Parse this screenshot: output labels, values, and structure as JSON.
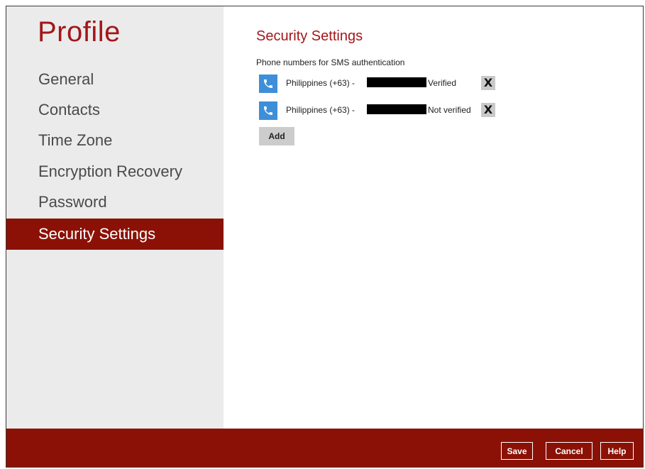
{
  "sidebar": {
    "title": "Profile",
    "items": [
      {
        "label": "General",
        "active": false
      },
      {
        "label": "Contacts",
        "active": false
      },
      {
        "label": "Time Zone",
        "active": false
      },
      {
        "label": "Encryption Recovery",
        "active": false
      },
      {
        "label": "Password",
        "active": false
      },
      {
        "label": "Security Settings",
        "active": true
      }
    ]
  },
  "main": {
    "title": "Security Settings",
    "subtitle": "Phone numbers for SMS authentication",
    "phones": [
      {
        "country": "Philippines (+63) -",
        "status": "Verified",
        "delete_label": "X",
        "icon": "phone-icon"
      },
      {
        "country": "Philippines (+63) -",
        "status": "Not verified",
        "delete_label": "X",
        "icon": "phone-icon"
      }
    ],
    "add_label": "Add"
  },
  "footer": {
    "save_label": "Save",
    "cancel_label": "Cancel",
    "help_label": "Help"
  },
  "colors": {
    "brand_red": "#8b1106",
    "title_red": "#a4161a",
    "phone_icon_blue": "#3d8fd9",
    "sidebar_bg": "#ebebeb"
  }
}
